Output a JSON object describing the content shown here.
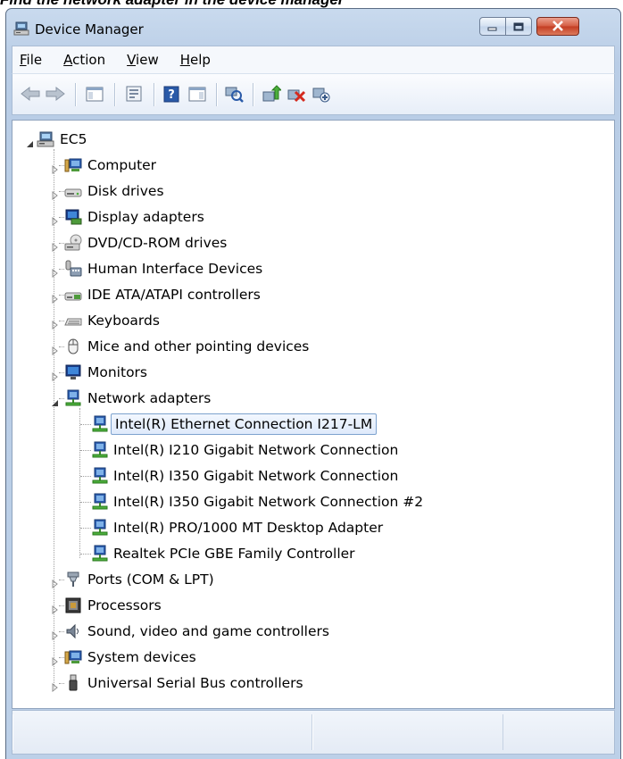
{
  "caption": "Find the network adapter in the device manager",
  "window": {
    "title": "Device Manager",
    "controls": [
      "minimize-icon",
      "maximize-icon",
      "close-icon"
    ]
  },
  "menu": [
    {
      "key": "F",
      "rest": "ile"
    },
    {
      "key": "A",
      "rest": "ction"
    },
    {
      "key": "V",
      "rest": "iew"
    },
    {
      "key": "H",
      "rest": "elp"
    }
  ],
  "toolbar": [
    "back-arrow-icon",
    "forward-arrow-icon",
    "show-hide-console-tree-icon",
    "properties-icon",
    "help-icon",
    "action-pane-icon",
    "scan-hardware-icon",
    "update-driver-icon",
    "uninstall-icon",
    "disable-device-icon"
  ],
  "tree": {
    "root": "EC5",
    "categories": [
      {
        "label": "Computer",
        "icon": "computer-icon",
        "expanded": false
      },
      {
        "label": "Disk drives",
        "icon": "disk-drive-icon",
        "expanded": false
      },
      {
        "label": "Display adapters",
        "icon": "display-adapter-icon",
        "expanded": false
      },
      {
        "label": "DVD/CD-ROM drives",
        "icon": "dvd-drive-icon",
        "expanded": false
      },
      {
        "label": "Human Interface Devices",
        "icon": "hid-icon",
        "expanded": false
      },
      {
        "label": "IDE ATA/ATAPI controllers",
        "icon": "ide-controller-icon",
        "expanded": false
      },
      {
        "label": "Keyboards",
        "icon": "keyboard-icon",
        "expanded": false
      },
      {
        "label": "Mice and other pointing devices",
        "icon": "mouse-icon",
        "expanded": false
      },
      {
        "label": "Monitors",
        "icon": "monitor-icon",
        "expanded": false
      },
      {
        "label": "Network adapters",
        "icon": "network-adapter-icon",
        "expanded": true,
        "children": [
          {
            "label": "Intel(R) Ethernet Connection I217-LM",
            "selected": true
          },
          {
            "label": "Intel(R) I210 Gigabit Network Connection"
          },
          {
            "label": "Intel(R) I350 Gigabit Network Connection"
          },
          {
            "label": "Intel(R) I350 Gigabit Network Connection #2"
          },
          {
            "label": "Intel(R) PRO/1000 MT Desktop Adapter"
          },
          {
            "label": "Realtek PCIe GBE Family Controller"
          }
        ]
      },
      {
        "label": "Ports (COM & LPT)",
        "icon": "port-icon",
        "expanded": false
      },
      {
        "label": "Processors",
        "icon": "processor-icon",
        "expanded": false
      },
      {
        "label": "Sound, video and game controllers",
        "icon": "sound-icon",
        "expanded": false
      },
      {
        "label": "System devices",
        "icon": "system-device-icon",
        "expanded": false
      },
      {
        "label": "Universal Serial Bus controllers",
        "icon": "usb-icon",
        "expanded": false
      }
    ]
  },
  "colors": {
    "selection_border": "#7da2ce",
    "selection_fill": "#dfeafb",
    "close_button": "#c33c22"
  }
}
